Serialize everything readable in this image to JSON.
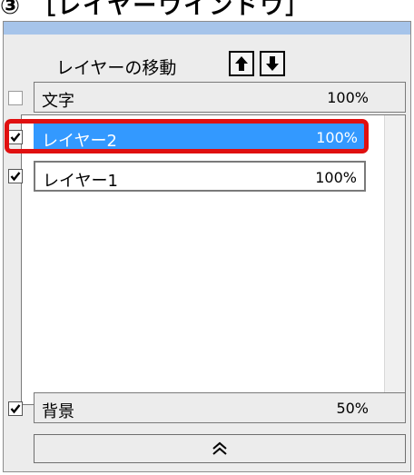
{
  "header_fragment": "③ ［レイヤーウインドウ］",
  "move_control": {
    "label": "レイヤーの移動",
    "up_icon": "arrow-up-icon",
    "down_icon": "arrow-down-icon"
  },
  "layers": {
    "text_layer": {
      "name": "文字",
      "opacity": "100%",
      "checked": false
    },
    "list": [
      {
        "name": "レイヤー2",
        "opacity": "100%",
        "checked": true,
        "selected": true
      },
      {
        "name": "レイヤー1",
        "opacity": "100%",
        "checked": true,
        "selected": false
      }
    ],
    "background_layer": {
      "name": "背景",
      "opacity": "50%",
      "checked": true
    }
  },
  "bottom_button": {
    "icon": "double-chevron-up-icon"
  },
  "colors": {
    "selection": "#3399ff",
    "highlight_outline": "#e01010",
    "title_strip": "#a6c4ea",
    "panel": "#ececec"
  }
}
